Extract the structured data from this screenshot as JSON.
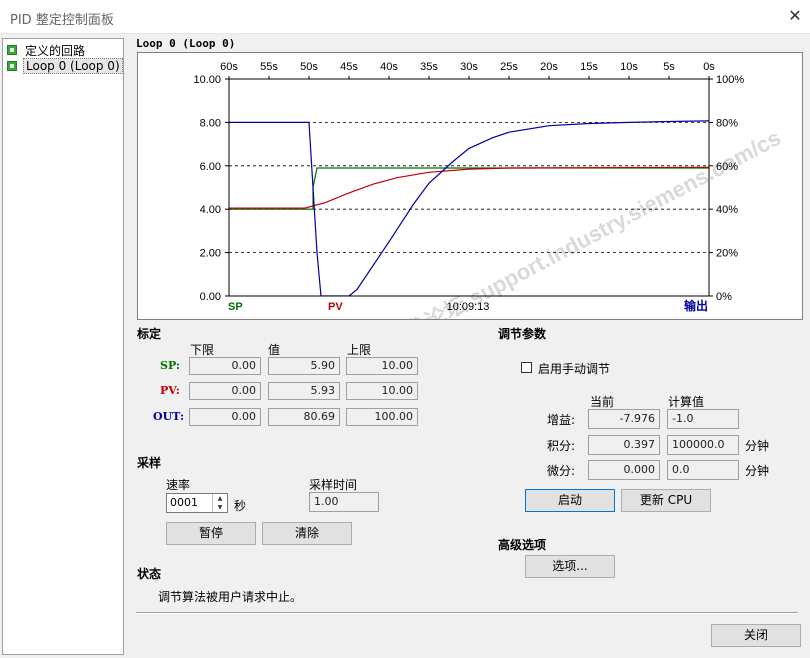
{
  "window": {
    "title": "PID 整定控制面板",
    "close_glyph": "✕"
  },
  "tree": {
    "items": [
      {
        "label": "定义的回路"
      },
      {
        "label": "Loop 0 (Loop 0)"
      }
    ]
  },
  "graph": {
    "title": "Loop 0 (Loop 0)",
    "time_labels": [
      "60s",
      "55s",
      "50s",
      "45s",
      "40s",
      "35s",
      "30s",
      "25s",
      "20s",
      "15s",
      "10s",
      "5s",
      "0s"
    ],
    "left_axis_labels": [
      "10.00",
      "8.00",
      "6.00",
      "4.00",
      "2.00",
      "0.00"
    ],
    "right_axis_labels": [
      "100%",
      "80%",
      "60%",
      "40%",
      "20%",
      "0%"
    ],
    "legend": {
      "sp": "SP",
      "pv": "PV",
      "out": "输出"
    },
    "timestamp": "10:09:13",
    "colors": {
      "sp": "#007000",
      "pv": "#c00000",
      "out": "#0000a0"
    },
    "watermark": "西门子工业  技术论坛  support.industry.siemens.com/cs"
  },
  "chart_data": {
    "type": "line",
    "title": "Loop 0 (Loop 0)",
    "x_unit": "s",
    "x": [
      60,
      55,
      50.2,
      49.5,
      49,
      48.5,
      45,
      40,
      35,
      30,
      25,
      20,
      15,
      10,
      5,
      0
    ],
    "xlim": [
      60,
      0
    ],
    "ylim_left": [
      0,
      10
    ],
    "ylim_right_percent": [
      0,
      100
    ],
    "grid": "dashed horizontal",
    "series": [
      {
        "name": "SP",
        "axis": "left",
        "points": [
          [
            60,
            4.0
          ],
          [
            49.5,
            4.0
          ],
          [
            49.5,
            5.0
          ],
          [
            49,
            5.9
          ],
          [
            0,
            5.9
          ]
        ]
      },
      {
        "name": "PV",
        "axis": "left",
        "points": [
          [
            60,
            4.05
          ],
          [
            50.5,
            4.05
          ],
          [
            48,
            4.3
          ],
          [
            45,
            4.75
          ],
          [
            42,
            5.15
          ],
          [
            39,
            5.45
          ],
          [
            35,
            5.7
          ],
          [
            30,
            5.85
          ],
          [
            25,
            5.9
          ],
          [
            0,
            5.93
          ]
        ]
      },
      {
        "name": "输出",
        "axis": "right_percent",
        "points": [
          [
            60,
            80
          ],
          [
            50,
            80
          ],
          [
            49,
            20
          ],
          [
            48.5,
            0
          ],
          [
            45,
            0
          ],
          [
            44,
            3
          ],
          [
            40,
            25
          ],
          [
            37,
            42
          ],
          [
            35,
            52
          ],
          [
            32,
            62
          ],
          [
            30,
            68
          ],
          [
            27,
            73
          ],
          [
            25,
            75.5
          ],
          [
            20,
            78.5
          ],
          [
            15,
            79.5
          ],
          [
            10,
            80
          ],
          [
            5,
            80.4
          ],
          [
            0,
            80.7
          ]
        ]
      }
    ]
  },
  "calibration": {
    "heading": "标定",
    "col_low": "下限",
    "col_value": "值",
    "col_high": "上限",
    "rows": [
      {
        "name": "SP:",
        "low": "0.00",
        "value": "5.90",
        "high": "10.00",
        "color": "#007000"
      },
      {
        "name": "PV:",
        "low": "0.00",
        "value": "5.93",
        "high": "10.00",
        "color": "#c00000"
      },
      {
        "name": "OUT:",
        "low": "0.00",
        "value": "80.69",
        "high": "100.00",
        "color": "#0000a0"
      }
    ]
  },
  "sampling": {
    "heading": "采样",
    "rate_label": "速率",
    "rate_value": "0001",
    "rate_unit": "秒",
    "time_label": "采样时间",
    "time_value": "1.00",
    "pause_button": "暂停",
    "clear_button": "清除"
  },
  "status": {
    "heading": "状态",
    "message": "调节算法被用户请求中止。"
  },
  "tuning": {
    "heading": "调节参数",
    "manual_checkbox_label": "启用手动调节",
    "manual_checked": false,
    "col_current": "当前",
    "col_calculated": "计算值",
    "gain_label": "增益:",
    "gain_current": "-7.976",
    "gain_calculated": "-1.0",
    "integral_label": "积分:",
    "integral_current": "0.397",
    "integral_calculated": "100000.0",
    "integral_unit": "分钟",
    "derivative_label": "微分:",
    "derivative_current": "0.000",
    "derivative_calculated": "0.0",
    "derivative_unit": "分钟",
    "start_button": "启动",
    "update_cpu_button": "更新 CPU"
  },
  "advanced": {
    "heading": "高级选项",
    "options_button": "选项..."
  },
  "footer": {
    "close_button": "关闭"
  }
}
